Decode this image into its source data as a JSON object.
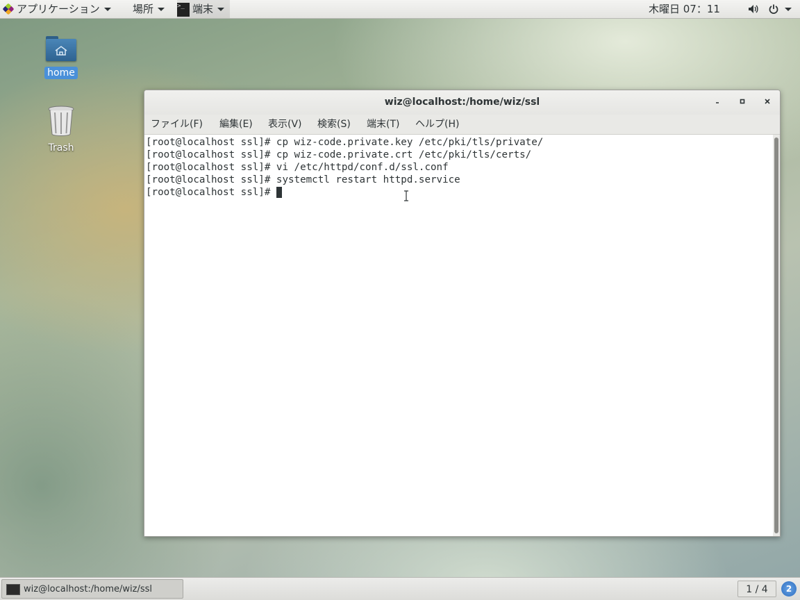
{
  "top_panel": {
    "applications_label": "アプリケーション",
    "places_label": "場所",
    "active_app_label": "端末",
    "clock": "木曜日 07：11"
  },
  "desktop": {
    "home_label": "home",
    "trash_label": "Trash"
  },
  "window": {
    "title": "wiz@localhost:/home/wiz/ssl",
    "menus": [
      "ファイル(F)",
      "編集(E)",
      "表示(V)",
      "検索(S)",
      "端末(T)",
      "ヘルプ(H)"
    ],
    "lines": [
      "[root@localhost ssl]# cp wiz-code.private.key /etc/pki/tls/private/",
      "[root@localhost ssl]# cp wiz-code.private.crt /etc/pki/tls/certs/",
      "[root@localhost ssl]# vi /etc/httpd/conf.d/ssl.conf",
      "[root@localhost ssl]# systemctl restart httpd.service",
      "[root@localhost ssl]# "
    ]
  },
  "bottom_panel": {
    "task_label": "wiz@localhost:/home/wiz/ssl",
    "workspace": "1 / 4",
    "help_badge": "2"
  }
}
